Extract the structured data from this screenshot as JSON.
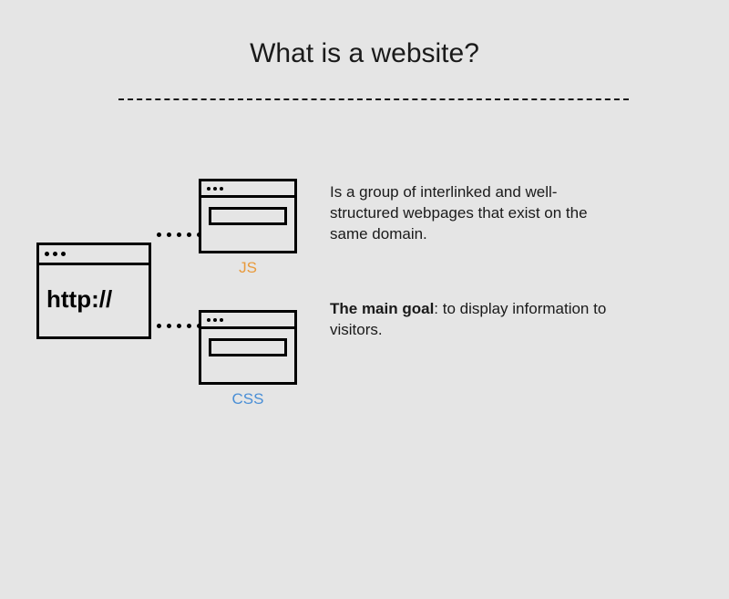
{
  "title": "What is a website?",
  "main_window": {
    "address_text": "http://"
  },
  "labels": {
    "js": "JS",
    "css": "CSS"
  },
  "paragraph1": "Is a group of interlinked and well-structured webpages that exist on the same domain.",
  "paragraph2": {
    "bold": "The main goal",
    "rest": ": to display information to visitors."
  }
}
